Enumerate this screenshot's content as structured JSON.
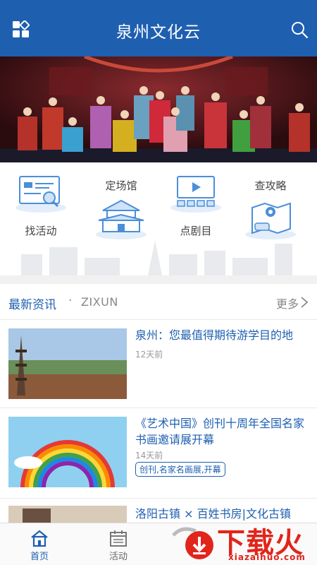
{
  "header": {
    "title": "泉州文化云",
    "menu_icon": "grid-menu-icon",
    "search_icon": "search-icon"
  },
  "colors": {
    "brand": "#1e5fb0",
    "watermark": "#e1251b"
  },
  "categories": [
    {
      "label": "找活动",
      "icon": "monitor-search-icon"
    },
    {
      "label": "定场馆",
      "icon": "temple-icon"
    },
    {
      "label": "点剧目",
      "icon": "theater-screen-icon"
    },
    {
      "label": "查攻略",
      "icon": "map-route-icon"
    }
  ],
  "news": {
    "title": "最新资讯",
    "dot": "·",
    "subtitle": "ZIXUN",
    "more": "更多",
    "items": [
      {
        "title": "泉州：您最值得期待游学目的地",
        "time": "12天前",
        "tag": ""
      },
      {
        "title": "《艺术中国》创刊十周年全国名家书画邀请展开幕",
        "time": "14天前",
        "tag": "创刊,名家名画展,开幕"
      },
      {
        "title": "洛阳古镇 × 百姓书房|文化古镇",
        "time": "",
        "tag": ""
      }
    ]
  },
  "nav": {
    "tabs": [
      {
        "label": "首页",
        "icon": "home-icon",
        "active": true
      },
      {
        "label": "活动",
        "icon": "calendar-icon",
        "active": false
      }
    ]
  },
  "watermark": {
    "text": "下载火",
    "domain": "xiazaihuo.com"
  }
}
